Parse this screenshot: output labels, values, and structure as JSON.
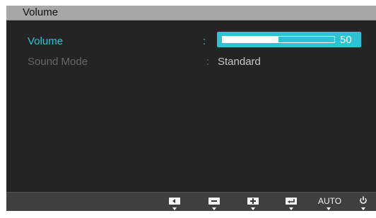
{
  "window": {
    "title": "Volume"
  },
  "menu": {
    "items": [
      {
        "label": "Volume",
        "separator": ":",
        "selected": true,
        "slider": {
          "value": "50",
          "level": 50,
          "max": 100
        }
      },
      {
        "label": "Sound Mode",
        "separator": ":",
        "value": "Standard"
      }
    ]
  },
  "bottom_bar": {
    "buttons": [
      {
        "name": "left",
        "icon": "left-arrow-icon"
      },
      {
        "name": "minus",
        "icon": "minus-icon"
      },
      {
        "name": "plus",
        "icon": "plus-icon"
      },
      {
        "name": "enter",
        "icon": "enter-icon"
      },
      {
        "name": "auto",
        "label": "AUTO"
      },
      {
        "name": "power",
        "icon": "power-icon"
      }
    ]
  },
  "colors": {
    "accent": "#2ec3d4",
    "background": "#242424",
    "title_bar": "#a7a7a7",
    "inactive_text": "#666666"
  }
}
